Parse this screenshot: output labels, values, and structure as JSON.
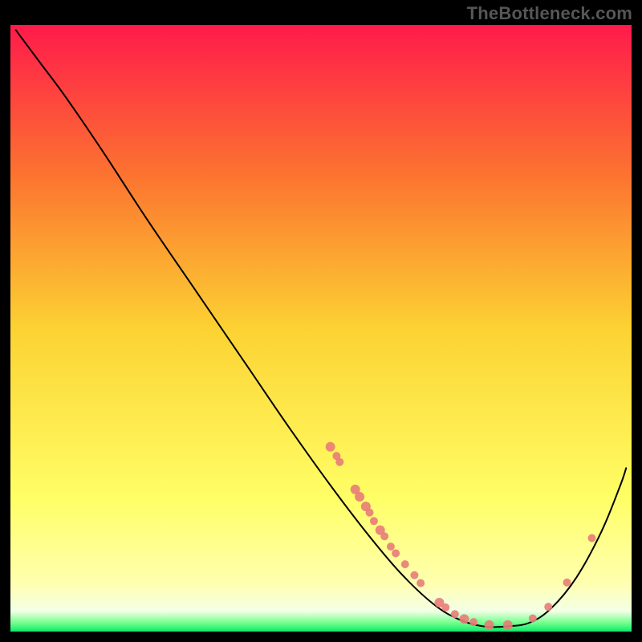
{
  "watermark": "TheBottleneck.com",
  "chart_data": {
    "type": "line",
    "title": "",
    "xlabel": "",
    "ylabel": "",
    "xlim": [
      0,
      100
    ],
    "ylim": [
      0,
      100
    ],
    "grid": false,
    "axes_visible": false,
    "background_gradient_stops": [
      {
        "offset": 0.0,
        "color": "#ff1a4b"
      },
      {
        "offset": 0.25,
        "color": "#fc7430"
      },
      {
        "offset": 0.5,
        "color": "#fcd232"
      },
      {
        "offset": 0.78,
        "color": "#ffff66"
      },
      {
        "offset": 0.92,
        "color": "#ffffb0"
      },
      {
        "offset": 0.965,
        "color": "#f3ffe6"
      },
      {
        "offset": 0.985,
        "color": "#6fff8a"
      },
      {
        "offset": 1.0,
        "color": "#00e868"
      }
    ],
    "curve": [
      {
        "x": 1.0,
        "y": 99.0
      },
      {
        "x": 5.0,
        "y": 93.5
      },
      {
        "x": 9.0,
        "y": 88.0
      },
      {
        "x": 15.0,
        "y": 79.0
      },
      {
        "x": 22.0,
        "y": 68.0
      },
      {
        "x": 30.0,
        "y": 56.0
      },
      {
        "x": 38.0,
        "y": 44.0
      },
      {
        "x": 45.0,
        "y": 33.5
      },
      {
        "x": 52.0,
        "y": 23.5
      },
      {
        "x": 58.0,
        "y": 15.5
      },
      {
        "x": 63.0,
        "y": 9.5
      },
      {
        "x": 68.0,
        "y": 4.7
      },
      {
        "x": 72.0,
        "y": 2.2
      },
      {
        "x": 76.0,
        "y": 1.0
      },
      {
        "x": 80.0,
        "y": 1.0
      },
      {
        "x": 83.5,
        "y": 1.6
      },
      {
        "x": 87.0,
        "y": 4.0
      },
      {
        "x": 91.0,
        "y": 9.0
      },
      {
        "x": 95.0,
        "y": 16.5
      },
      {
        "x": 98.0,
        "y": 24.0
      },
      {
        "x": 99.0,
        "y": 27.0
      }
    ],
    "scatter_points": [
      {
        "x": 51.5,
        "y": 30.5,
        "r": 6
      },
      {
        "x": 52.5,
        "y": 29.0,
        "r": 5
      },
      {
        "x": 53.0,
        "y": 28.0,
        "r": 5
      },
      {
        "x": 55.5,
        "y": 23.5,
        "r": 6
      },
      {
        "x": 56.2,
        "y": 22.3,
        "r": 6
      },
      {
        "x": 57.2,
        "y": 20.7,
        "r": 6
      },
      {
        "x": 57.8,
        "y": 19.7,
        "r": 5
      },
      {
        "x": 58.5,
        "y": 18.3,
        "r": 5
      },
      {
        "x": 59.5,
        "y": 16.8,
        "r": 6
      },
      {
        "x": 60.2,
        "y": 15.8,
        "r": 5
      },
      {
        "x": 61.2,
        "y": 14.1,
        "r": 5
      },
      {
        "x": 62.0,
        "y": 13.0,
        "r": 5
      },
      {
        "x": 63.5,
        "y": 11.2,
        "r": 5
      },
      {
        "x": 65.0,
        "y": 9.4,
        "r": 5
      },
      {
        "x": 66.0,
        "y": 8.1,
        "r": 5
      },
      {
        "x": 69.0,
        "y": 4.9,
        "r": 6
      },
      {
        "x": 70.0,
        "y": 4.1,
        "r": 5
      },
      {
        "x": 71.5,
        "y": 3.0,
        "r": 5
      },
      {
        "x": 73.0,
        "y": 2.2,
        "r": 6
      },
      {
        "x": 74.5,
        "y": 1.7,
        "r": 5
      },
      {
        "x": 77.0,
        "y": 1.2,
        "r": 6
      },
      {
        "x": 80.0,
        "y": 1.2,
        "r": 6
      },
      {
        "x": 84.0,
        "y": 2.3,
        "r": 5
      },
      {
        "x": 86.5,
        "y": 4.2,
        "r": 5
      },
      {
        "x": 89.5,
        "y": 8.2,
        "r": 5
      },
      {
        "x": 93.5,
        "y": 15.5,
        "r": 5
      }
    ],
    "colors": {
      "curve_stroke": "#000000",
      "point_fill": "#e87c78",
      "frame_stroke": "#000000"
    }
  }
}
